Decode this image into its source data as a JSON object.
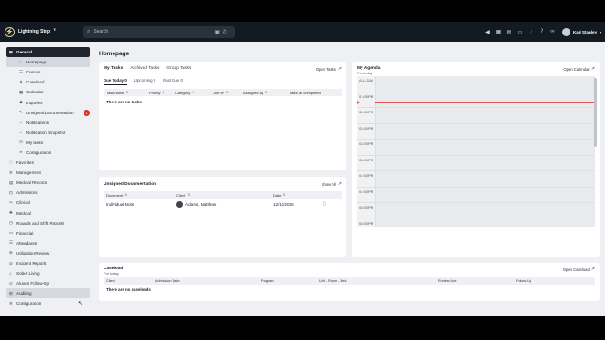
{
  "app": {
    "name": "Lightning Step",
    "user_name": "Karl Stanley"
  },
  "search": {
    "placeholder": "Search"
  },
  "sidebar": {
    "items": [
      {
        "label": "General",
        "icon": "grid-icon"
      },
      {
        "label": "Homepage",
        "icon": "home-icon"
      },
      {
        "label": "Census",
        "icon": "census-icon"
      },
      {
        "label": "Caseload",
        "icon": "person-icon"
      },
      {
        "label": "Calendar",
        "icon": "calendar-icon"
      },
      {
        "label": "Inquiries",
        "icon": "person-icon"
      },
      {
        "label": "Unsigned Documentation",
        "icon": "pen-icon",
        "badge": "1"
      },
      {
        "label": "Notifications",
        "icon": "bell-icon"
      },
      {
        "label": "Notification Snapshot",
        "icon": "bell-icon"
      },
      {
        "label": "My tasks",
        "icon": "list-icon"
      },
      {
        "label": "Configuration",
        "icon": "gear-icon"
      },
      {
        "label": "Favorites",
        "icon": "heart-icon"
      },
      {
        "label": "Management",
        "icon": "gear-icon"
      },
      {
        "label": "Medical Records",
        "icon": "folder-icon"
      },
      {
        "label": "Admissions",
        "icon": "door-icon"
      },
      {
        "label": "Clinical",
        "icon": "clinical-icon"
      },
      {
        "label": "Medical",
        "icon": "medical-icon"
      },
      {
        "label": "Rounds and Shift Reports",
        "icon": "clock-icon"
      },
      {
        "label": "Financial",
        "icon": "money-icon"
      },
      {
        "label": "Attendance",
        "icon": "attendance-icon"
      },
      {
        "label": "Utilization Review",
        "icon": "review-icon"
      },
      {
        "label": "Incident Reports",
        "icon": "alert-icon"
      },
      {
        "label": "Sober Living",
        "icon": "home-icon"
      },
      {
        "label": "Alumni Follow-Up",
        "icon": "alumni-icon"
      },
      {
        "label": "Auditing",
        "icon": "audit-icon"
      },
      {
        "label": "Configuration",
        "icon": "gear-icon"
      }
    ]
  },
  "page": {
    "title": "Homepage"
  },
  "tasks": {
    "tabs": [
      "My Tasks",
      "Archived Tasks",
      "Group Tasks"
    ],
    "open_link": "Open Tasks",
    "subtabs": [
      "Due Today 0",
      "Upcoming 0",
      "Past Due 0"
    ],
    "columns": [
      "Task name",
      "Priority",
      "Category",
      "Due by",
      "Assigned by",
      "Mark as completed"
    ],
    "empty": "There are no tasks"
  },
  "unsigned": {
    "title": "Unsigned Documentation",
    "show_all": "Show All",
    "columns": [
      "Document",
      "Client",
      "Date"
    ],
    "rows": [
      {
        "document": "Individual Note",
        "client": "Adams, Matthew",
        "date": "12/11/2025"
      }
    ]
  },
  "agenda": {
    "title": "My Agenda",
    "subtitle": "For today",
    "open_link": "Open Calendar",
    "slots": [
      "ALL-DAY",
      "01:00PM",
      "02:00PM",
      "02:00PM",
      "03:00PM",
      "03:00PM",
      "04:00PM",
      "04:00PM",
      "05:00PM",
      "05:00PM"
    ]
  },
  "caseload": {
    "title": "Caseload",
    "subtitle": "For today",
    "open_link": "Open Caseload",
    "columns": [
      "Client",
      "Admission Date",
      "Program",
      "Unit - Room - Bed",
      "Review Due",
      "Follow-Up"
    ],
    "empty": "There are no caseloads"
  }
}
